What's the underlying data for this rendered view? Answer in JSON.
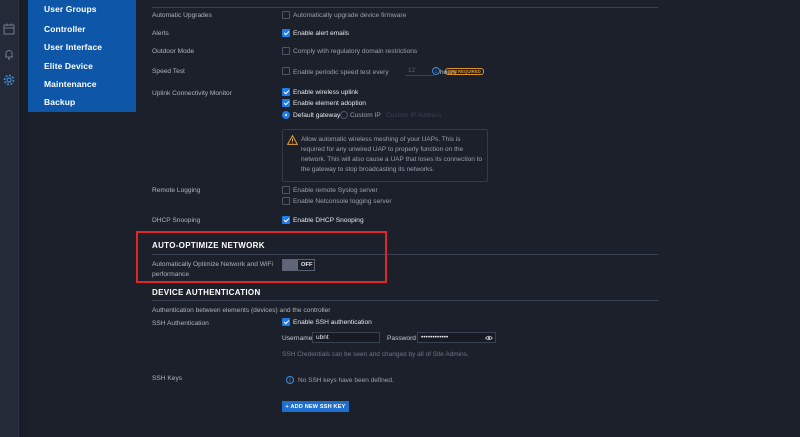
{
  "submenu": {
    "items": [
      {
        "label": "User Groups"
      },
      {
        "label": "Controller"
      },
      {
        "label": "User Interface"
      },
      {
        "label": "Elite Device"
      },
      {
        "label": "Maintenance"
      },
      {
        "label": "Backup"
      }
    ]
  },
  "services": {
    "automatic_upgrades": {
      "label": "Automatic Upgrades",
      "option": "Automatically upgrade device firmware",
      "checked": false
    },
    "alerts": {
      "label": "Alerts",
      "option": "Enable alert emails",
      "checked": true
    },
    "outdoor_mode": {
      "label": "Outdoor Mode",
      "option": "Comply with regulatory domain restrictions",
      "checked": false
    },
    "speed_test": {
      "label": "Speed Test",
      "option": "Enable periodic speed test every",
      "value": "12",
      "unit": "hours",
      "badge": "SSH REQUIRED",
      "checked": false
    },
    "uplink": {
      "label": "Uplink Connectivity Monitor",
      "wireless_uplink": "Enable wireless uplink",
      "element_adoption": "Enable element adoption",
      "default_gateway": "Default gateway",
      "custom_ip": "Custom IP",
      "custom_ip_placeholder": "Custom IP Address",
      "warning": "Allow automatic wireless meshing of your UAPs. This is required for any unwired UAP to properly function on the network. This will also cause a UAP that loses its connection to the gateway to stop broadcasting its networks."
    },
    "remote_logging": {
      "label": "Remote Logging",
      "syslog": "Enable remote Syslog server",
      "netconsole": "Enable Netconsole logging server"
    },
    "dhcp_snooping": {
      "label": "DHCP Snooping",
      "option": "Enable DHCP Snooping",
      "checked": true
    }
  },
  "auto_optimize": {
    "title": "AUTO-OPTIMIZE NETWORK",
    "label": "Automatically Optimize Network and WiFi performance",
    "toggle_state": "OFF"
  },
  "device_auth": {
    "title": "DEVICE AUTHENTICATION",
    "description": "Authentication between elements (devices) and the controller",
    "ssh_label": "SSH Authentication",
    "ssh_option": "Enable SSH authentication",
    "username_label": "Username",
    "username_value": "ubnt",
    "password_label": "Password",
    "password_value": "••••••••••••",
    "hint": "SSH Credentials can be seen and changed by all of Site Admins.",
    "ssh_keys_label": "SSH Keys",
    "no_keys": "No SSH keys have been defined.",
    "add_key_button": "+ ADD NEW SSH KEY"
  },
  "colors": {
    "background": "#1c202b",
    "submenu": "#0e57a8",
    "accent": "#1f7ce6",
    "highlight_box": "#e0262b",
    "warning": "#e6a23c"
  },
  "icons": [
    "calendar-icon",
    "bell-icon",
    "gear-icon",
    "warning-icon",
    "info-icon",
    "eye-icon"
  ]
}
